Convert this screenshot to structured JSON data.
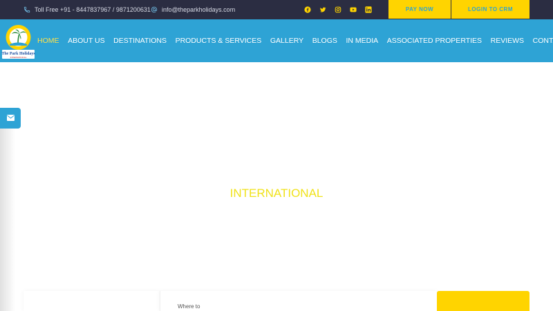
{
  "topbar": {
    "phone_text": "Toll Free +91 - 8447837967 / 9871200631",
    "email_text": "info@theparkholidays.com",
    "social_icons": [
      "facebook-icon",
      "twitter-icon",
      "instagram-icon",
      "youtube-icon",
      "linkedin-icon"
    ],
    "pay_now": "PAY NOW",
    "login_crm": "LOGIN TO CRM"
  },
  "logo": {
    "brand_line1": "The Park Holidays",
    "brand_line2": "INTERNATIONAL"
  },
  "nav": {
    "items": [
      {
        "label": "HOME",
        "active": true
      },
      {
        "label": "ABOUT US"
      },
      {
        "label": "DESTINATIONS"
      },
      {
        "label": "PRODUCTS & SERVICES"
      },
      {
        "label": "GALLERY"
      },
      {
        "label": "BLOGS"
      },
      {
        "label": "IN MEDIA"
      },
      {
        "label": "ASSOCIATED PROPERTIES"
      },
      {
        "label": "REVIEWS"
      },
      {
        "label": "CONTACT US"
      }
    ]
  },
  "hero": {
    "heading": "INTERNATIONAL"
  },
  "search": {
    "where_label": "Where to"
  },
  "colors": {
    "topbar_bg": "#2b2d42",
    "nav_bg": "#2ea3d5",
    "accent_yellow": "#ffd400",
    "active_nav": "#ffe14a"
  }
}
